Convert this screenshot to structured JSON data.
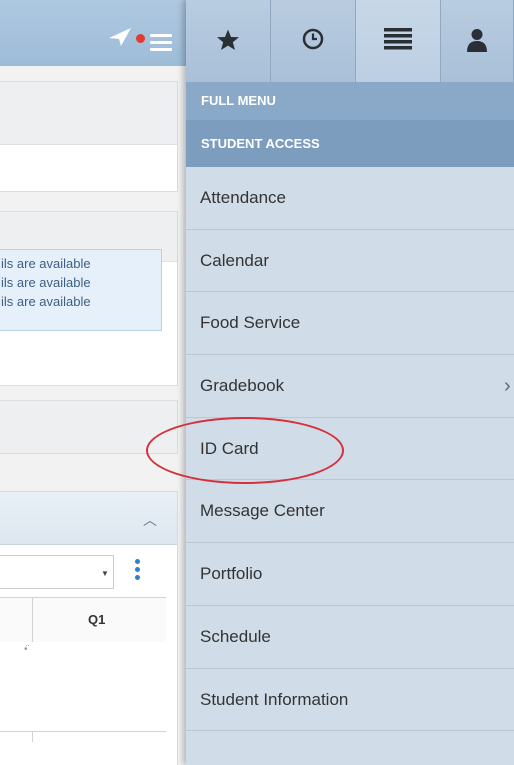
{
  "left_panel": {
    "info_lines": [
      "ils are available",
      "ils are available",
      "ils are available"
    ],
    "grid_header_q1": "Q1",
    "grid_cell_dots": "•̈"
  },
  "tabs": [
    {
      "icon": "star-icon"
    },
    {
      "icon": "clock-icon"
    },
    {
      "icon": "list-icon",
      "active": true
    },
    {
      "icon": "person-icon"
    }
  ],
  "menu": {
    "header": "FULL MENU",
    "section": "STUDENT ACCESS",
    "items": [
      {
        "label": "Attendance"
      },
      {
        "label": "Calendar"
      },
      {
        "label": "Food Service"
      },
      {
        "label": "Gradebook",
        "has_submenu": true
      },
      {
        "label": "ID Card",
        "highlighted": true
      },
      {
        "label": "Message Center"
      },
      {
        "label": "Portfolio"
      },
      {
        "label": "Schedule"
      },
      {
        "label": "Student Information"
      }
    ]
  },
  "colors": {
    "accent_blue": "#2f7fc8",
    "notification_red": "#e23a31",
    "highlight_circle": "#d5303b"
  }
}
